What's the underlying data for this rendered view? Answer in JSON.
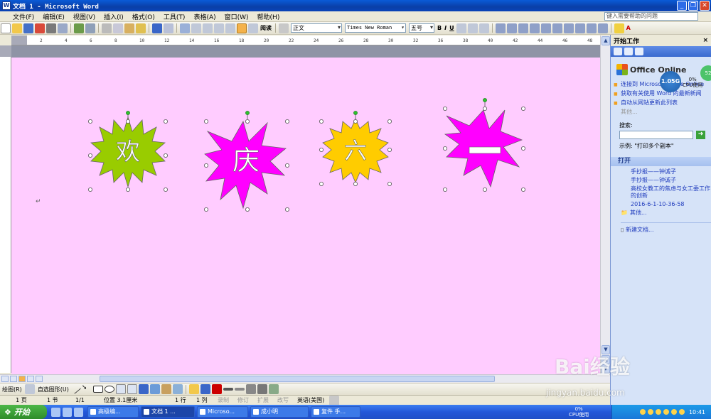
{
  "window": {
    "title": "文档 1 - Microsoft Word",
    "app_icon": "W"
  },
  "menu": {
    "items": [
      "文件(F)",
      "编辑(E)",
      "视图(V)",
      "插入(I)",
      "格式(O)",
      "工具(T)",
      "表格(A)",
      "窗口(W)",
      "帮助(H)"
    ],
    "help_placeholder": "键入需要帮助的问题"
  },
  "toolbar": {
    "read_label": "阅读",
    "style": "正文",
    "font": "Times New Roman",
    "size": "五号",
    "bold": "B",
    "italic": "I",
    "underline": "U",
    "font_color": "A"
  },
  "ruler": {
    "ticks": [
      "2",
      "4",
      "6",
      "8",
      "10",
      "12",
      "14",
      "16",
      "18",
      "20",
      "22",
      "24",
      "26",
      "28",
      "30",
      "32",
      "36",
      "38",
      "40",
      "42",
      "44",
      "46",
      "48"
    ]
  },
  "document": {
    "background": "#ffccff",
    "shapes": [
      {
        "text": "欢",
        "fill": "#99cc00"
      },
      {
        "text": "庆",
        "fill": "#ff00ff"
      },
      {
        "text": "六",
        "fill": "#ffcc00"
      },
      {
        "text": "一",
        "fill": "#ff00ff"
      }
    ]
  },
  "drawing_toolbar": {
    "draw_label": "绘图(R)",
    "autoshapes_label": "自选图形(U)"
  },
  "status_bar": {
    "page": "1 页",
    "section": "1 节",
    "page_of": "1/1",
    "position": "位置 3.1厘米",
    "line": "1 行",
    "column": "1 列",
    "record": "录制",
    "revise": "修订",
    "extend": "扩展",
    "overwrite": "改写",
    "language": "英语(美国)"
  },
  "task_pane": {
    "title": "开始工作",
    "close": "×",
    "office_online": "Office Online",
    "online_links": [
      "连接到 Microsoft Office Online",
      "获取有关使用 Word 的最新新闻",
      "自动从网站更新此列表"
    ],
    "more": "其他...",
    "search_label": "搜索:",
    "example": "示例: \"打印多个副本\"",
    "open_title": "打开",
    "recent_files": [
      "手抄报——钟诚子",
      "手抄报——钟诚子",
      "高校女教工的焦虑与女工委工作的创新",
      "2016-6-1-10-36-58"
    ],
    "other_files": "其他...",
    "new_document": "新建文档..."
  },
  "cpu_widget": {
    "memory": "1.05G",
    "percent": "0%",
    "label": "CPU使用",
    "side": "52"
  },
  "watermark": {
    "brand": "Bai经验",
    "url": "jingyan.baidu.com"
  },
  "taskbar": {
    "start": "开始",
    "tasks": [
      "高级编...",
      "文档 1 ...",
      "Microso...",
      "成小明",
      "复件 手..."
    ],
    "cpu_percent": "0%",
    "cpu_label": "CPU使用",
    "clock": "10:41"
  }
}
